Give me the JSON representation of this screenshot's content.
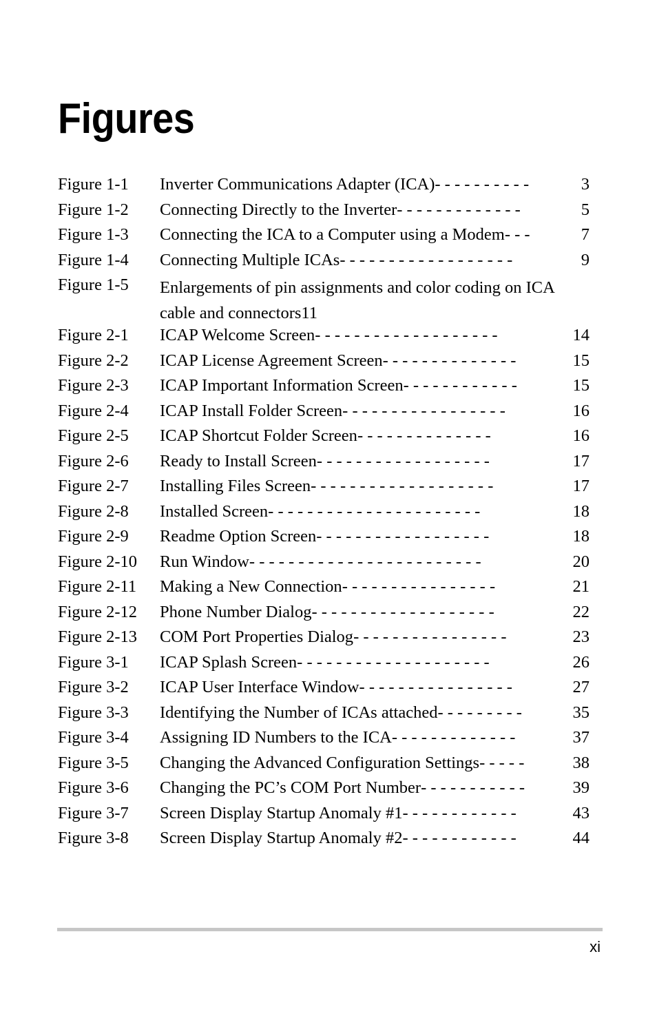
{
  "document": {
    "heading": "Figures",
    "footer_page_number": "xi",
    "leader_char": "-"
  },
  "figures": [
    {
      "label": "Figure 1-1",
      "title": "Inverter Communications Adapter (ICA)",
      "leader": " - - - - - - - - - -",
      "page": "3"
    },
    {
      "label": "Figure 1-2",
      "title": "Connecting Directly to the Inverter",
      "leader": " - - - - - - - - - - - - -",
      "page": "5"
    },
    {
      "label": "Figure 1-3",
      "title": "Connecting the ICA to a Computer using a Modem",
      "leader": " - - -",
      "page": "7"
    },
    {
      "label": "Figure 1-4",
      "title": "Connecting Multiple ICAs",
      "leader": " - - - - - - - - - - - - - - - - - -",
      "page": "9"
    },
    {
      "label": "Figure 1-5",
      "title": "Enlargements of pin assignments and color coding on ICA cable and connectors11",
      "leader": "",
      "page": "",
      "wrapped": true
    },
    {
      "label": "Figure 2-1",
      "title": "ICAP Welcome Screen",
      "leader": " - - - - - - - - - - - - - - - - - - -",
      "page": "14"
    },
    {
      "label": "Figure 2-2",
      "title": "ICAP License Agreement Screen",
      "leader": "- - - - - - - - - - - - - -",
      "page": "15"
    },
    {
      "label": "Figure 2-3",
      "title": "ICAP Important Information Screen",
      "leader": "- - - - - - - - - - - -",
      "page": "15"
    },
    {
      "label": "Figure 2-4",
      "title": "ICAP Install Folder Screen",
      "leader": "- - - - - - - - - - - - - - - - -",
      "page": "16"
    },
    {
      "label": "Figure 2-5",
      "title": "ICAP Shortcut Folder Screen",
      "leader": " - - - - - - - - - - - - - -",
      "page": "16"
    },
    {
      "label": "Figure 2-6",
      "title": "Ready to Install Screen",
      "leader": " - - - - - - - - - - - - - - - - - -",
      "page": "17"
    },
    {
      "label": "Figure 2-7",
      "title": "Installing Files Screen",
      "leader": " - - - - - - - - - - - - - - - - - - -",
      "page": "17"
    },
    {
      "label": "Figure 2-8",
      "title": "Installed Screen",
      "leader": " - - - - - - - - - - - - - - - - - - - - - -",
      "page": "18"
    },
    {
      "label": "Figure 2-9",
      "title": "Readme Option Screen",
      "leader": " - - - - - - - - - - - - - - - - - -",
      "page": "18"
    },
    {
      "label": "Figure 2-10",
      "title": "Run Window",
      "leader": " - - - - - - - - - - - - - - - - - - - - - - - -",
      "page": "20"
    },
    {
      "label": "Figure 2-11",
      "title": "Making a New Connection",
      "leader": "- - - - - - - - - - - - - - - -",
      "page": "21"
    },
    {
      "label": "Figure 2-12",
      "title": "Phone Number Dialog",
      "leader": "- - - - - - - - - - - - - - - - - - -",
      "page": "22"
    },
    {
      "label": "Figure 2-13",
      "title": "COM Port Properties Dialog",
      "leader": "- - - - - - - - - - - - - - - -",
      "page": "23"
    },
    {
      "label": "Figure 3-1",
      "title": "ICAP Splash Screen",
      "leader": " - - - - - - - - - - - - - - - - - - - -",
      "page": "26"
    },
    {
      "label": "Figure 3-2",
      "title": "ICAP User Interface Window",
      "leader": "- - - - - - - - - - - - - - - -",
      "page": "27"
    },
    {
      "label": "Figure 3-3",
      "title": "Identifying the Number of ICAs attached",
      "leader": " - - - - - - - - -",
      "page": "35"
    },
    {
      "label": "Figure 3-4",
      "title": "Assigning ID Numbers to the ICA",
      "leader": "- - - - - - - - - - - - -",
      "page": "37"
    },
    {
      "label": "Figure 3-5",
      "title": "Changing the Advanced Configuration Settings",
      "leader": "- - - - -",
      "page": "38"
    },
    {
      "label": "Figure 3-6",
      "title": "Changing the PC’s COM Port Number",
      "leader": "- - - - - - - - - - -",
      "page": "39"
    },
    {
      "label": "Figure 3-7",
      "title": "Screen Display Startup Anomaly #1",
      "leader": "- - - - - - - - - - - -",
      "page": "43"
    },
    {
      "label": "Figure 3-8",
      "title": "Screen Display Startup Anomaly #2",
      "leader": "- - - - - - - - - - - -",
      "page": "44"
    }
  ]
}
